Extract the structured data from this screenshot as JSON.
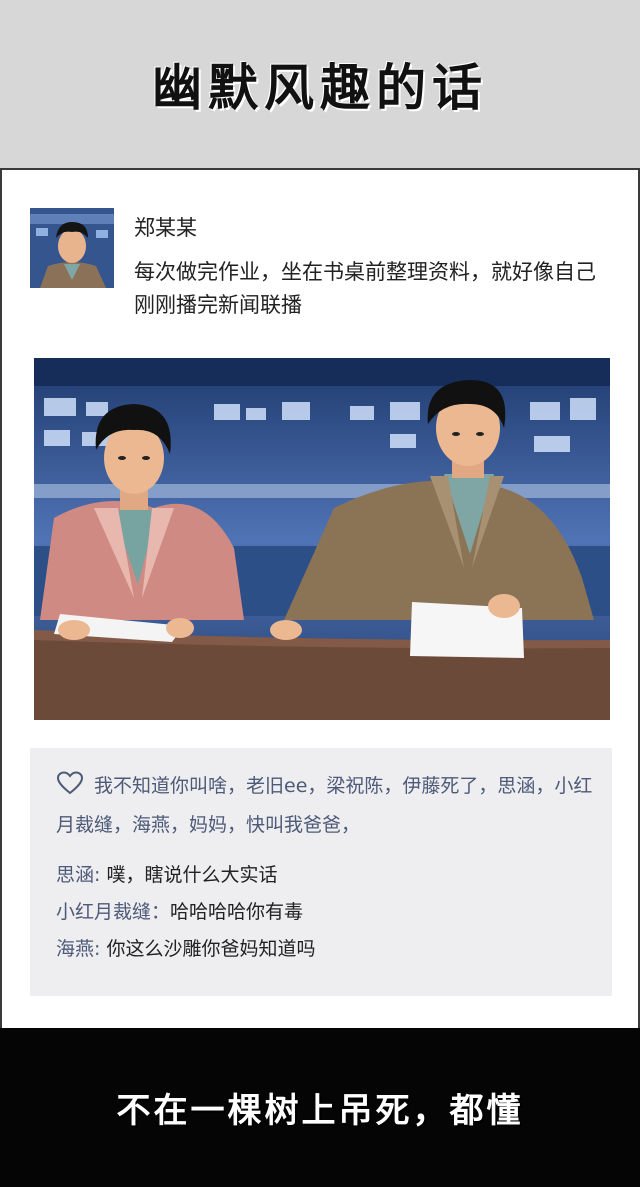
{
  "header": {
    "title": "幽默风趣的话"
  },
  "post": {
    "username": "郑某某",
    "text": "每次做完作业，坐在书桌前整理资料，就好像自己刚刚播完新闻联播"
  },
  "comments_panel": {
    "likes_text": "我不知道你叫啥，老旧ee，梁祝陈，伊藤死了，思涵，小红月裁缝，海燕，妈妈，快叫我爸爸，",
    "comments": [
      {
        "name": "思涵",
        "sep": ": ",
        "text": "噗，瞎说什么大实话"
      },
      {
        "name": "小红月裁缝",
        "sep": "：",
        "text": "哈哈哈哈你有毒"
      },
      {
        "name": "海燕",
        "sep": ": ",
        "text": "你这么沙雕你爸妈知道吗"
      }
    ]
  },
  "footer": {
    "text": "不在一棵树上吊死，都懂"
  },
  "colors": {
    "header_bg": "#d7d7d7",
    "footer_bg": "#050505",
    "comment_panel_bg": "#eeeef0",
    "name_color": "#4d5a78",
    "desk_color": "#6b4a3a",
    "studio_blue": "#2e4f86"
  },
  "icons": {
    "like": "heart-outline-icon"
  }
}
